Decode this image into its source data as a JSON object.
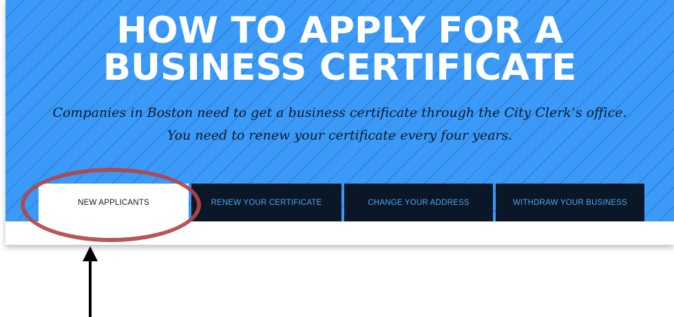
{
  "hero": {
    "title_line1": "HOW TO APPLY FOR A",
    "title_line2": "BUSINESS CERTIFICATE",
    "subtitle_line1": "Companies in Boston need to get a business certificate through the City Clerk’s office.",
    "subtitle_line2": "You need to renew your certificate every four years."
  },
  "tabs": [
    {
      "label": "NEW APPLICANTS",
      "active": true
    },
    {
      "label": "RENEW YOUR CERTIFICATE",
      "active": false
    },
    {
      "label": "CHANGE YOUR ADDRESS",
      "active": false
    },
    {
      "label": "WITHDRAW YOUR BUSINESS",
      "active": false
    }
  ],
  "colors": {
    "hero_bg": "#3b9af8",
    "tab_bg": "#0b1626",
    "tab_text": "#4aa5f5",
    "highlight": "#b24646"
  }
}
